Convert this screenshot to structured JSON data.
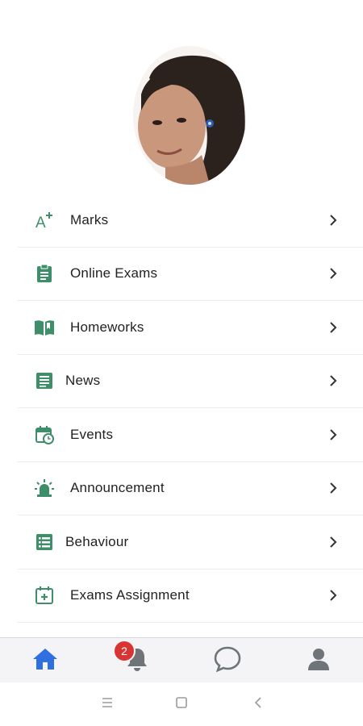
{
  "profile": {
    "avatar_alt": "Student profile photo"
  },
  "menu": {
    "items": [
      {
        "label": "Marks",
        "icon": "grade-plus-icon"
      },
      {
        "label": "Online Exams",
        "icon": "clipboard-icon"
      },
      {
        "label": "Homeworks",
        "icon": "book-icon"
      },
      {
        "label": "News",
        "icon": "newspaper-icon"
      },
      {
        "label": "Events",
        "icon": "calendar-clock-icon"
      },
      {
        "label": "Announcement",
        "icon": "alarm-light-icon"
      },
      {
        "label": "Behaviour",
        "icon": "list-icon"
      },
      {
        "label": "Exams Assignment",
        "icon": "calendar-plus-icon"
      }
    ]
  },
  "bottom_nav": {
    "notification_count": "2",
    "items": [
      {
        "name": "home",
        "icon": "home-icon"
      },
      {
        "name": "notifications",
        "icon": "bell-icon"
      },
      {
        "name": "messages",
        "icon": "chat-icon"
      },
      {
        "name": "profile",
        "icon": "person-icon"
      }
    ]
  },
  "colors": {
    "icon_green": "#3e8e6a",
    "active_blue": "#2f6fe0",
    "inactive_gray": "#6f7479",
    "badge_red": "#d93434"
  }
}
